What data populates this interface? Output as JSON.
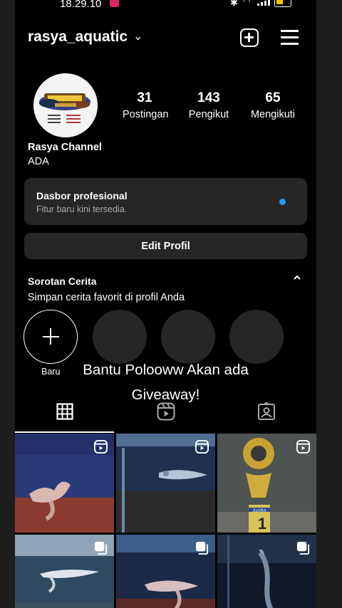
{
  "status_bar": {
    "time": "18.29.10"
  },
  "header": {
    "username": "rasya_aquatic"
  },
  "profile": {
    "name": "Rasya Channel",
    "bio": "ADA",
    "stats": [
      {
        "value": "31",
        "label": "Postingan"
      },
      {
        "value": "143",
        "label": "Pengikut"
      },
      {
        "value": "65",
        "label": "Mengikuti"
      }
    ]
  },
  "dashboard": {
    "title": "Dasbor profesional",
    "subtitle": "Fitur baru kini tersedia.",
    "accent": "#1d9bf0"
  },
  "edit_button": "Edit Profil",
  "highlights": {
    "title": "Sorotan Cerita",
    "subtitle": "Simpan cerita favorit di profil Anda",
    "new_label": "Baru"
  },
  "overlay_caption": {
    "line1": "Bantu Polooww Akan ada",
    "line2": "Giveaway!"
  },
  "tabs": [
    {
      "name": "grid",
      "icon": "grid-icon",
      "active": true
    },
    {
      "name": "reels",
      "icon": "reels-icon",
      "active": false
    },
    {
      "name": "tagged",
      "icon": "tagged-icon",
      "active": false
    }
  ],
  "posts": [
    {
      "type": "reel",
      "subject": "fish-in-aquarium"
    },
    {
      "type": "reel",
      "subject": "fish-in-aquarium"
    },
    {
      "type": "reel",
      "subject": "trophy",
      "label": "JUARA"
    },
    {
      "type": "carousel",
      "subject": "fish-in-aquarium"
    },
    {
      "type": "carousel",
      "subject": "fish-in-aquarium"
    },
    {
      "type": "carousel",
      "subject": "fish-in-aquarium"
    }
  ]
}
